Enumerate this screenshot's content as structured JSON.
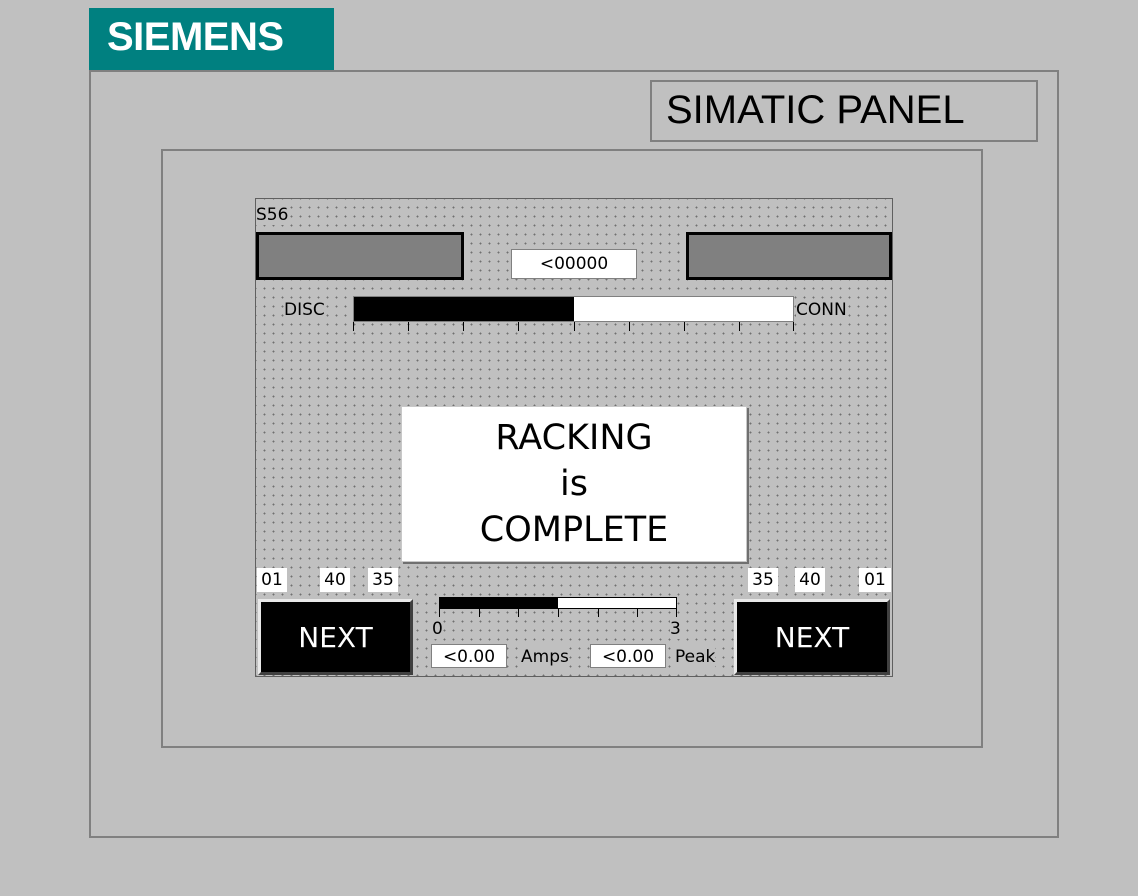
{
  "header": {
    "brand": "SIEMENS",
    "panel_label": "SIMATIC PANEL",
    "brand_color": "#008080"
  },
  "screen": {
    "station_id": "S56",
    "counter": "<00000",
    "position_bar": {
      "left_label": "DISC",
      "right_label": "CONN",
      "fill_fraction": 0.5,
      "tick_count": 9
    },
    "message": {
      "line1": "RACKING",
      "line2": "is",
      "line3": "COMPLETE"
    },
    "left_numbers": [
      "01",
      "40",
      "35"
    ],
    "right_numbers": [
      "35",
      "40",
      "01"
    ],
    "next_left_label": "NEXT",
    "next_right_label": "NEXT",
    "amp_bar": {
      "min_label": "0",
      "max_label": "3",
      "fill_fraction": 0.5,
      "tick_count": 7
    },
    "amps_value": "<0.00",
    "amps_unit": "Amps",
    "peak_value": "<0.00",
    "peak_unit": "Peak"
  }
}
